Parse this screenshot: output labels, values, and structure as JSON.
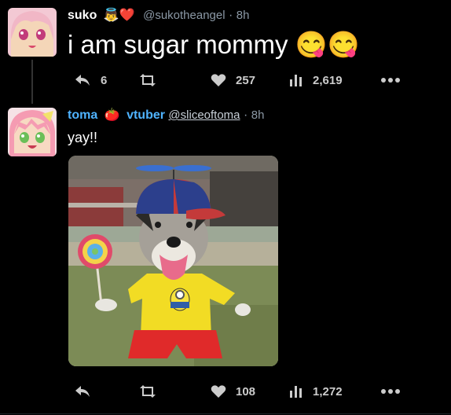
{
  "tweets": [
    {
      "name": "suko",
      "name_emojis": "👼❤️",
      "handle": "@sukotheangel",
      "separator": "·",
      "time": "8h",
      "text": "i am sugar mommy 😋😋",
      "replies": "6",
      "retweets": "",
      "likes": "257",
      "views": "2,619",
      "avatar_icon": "anime-girl-avatar"
    },
    {
      "name": "toma",
      "name_emoji": "🍅",
      "name_suffix": "vtuber",
      "handle": "@sliceoftoma",
      "separator": "·",
      "time": "8h",
      "text": "yay!!",
      "replies": "",
      "retweets": "",
      "likes": "108",
      "views": "1,272",
      "avatar_icon": "anime-girl-avatar",
      "media_description_icon": "dog-in-costume-image"
    }
  ],
  "colors": {
    "background": "#000000",
    "accent_name": "#4fb3ff",
    "muted": "#8b98a5",
    "action": "#cccccc"
  }
}
